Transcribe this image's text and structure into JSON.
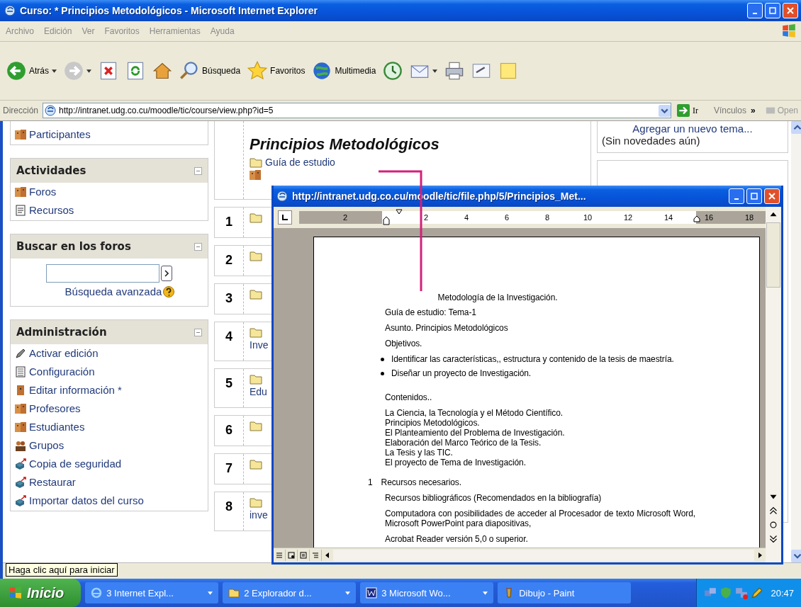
{
  "window": {
    "title": "Curso: * Principios Metodológicos - Microsoft Internet Explorer"
  },
  "menu": [
    "Archivo",
    "Edición",
    "Ver",
    "Favoritos",
    "Herramientas",
    "Ayuda"
  ],
  "toolbar": [
    {
      "kind": "back",
      "label": "Atrás",
      "dropdown": true
    },
    {
      "kind": "forward",
      "dropdown": true
    },
    {
      "kind": "stop"
    },
    {
      "kind": "refresh"
    },
    {
      "kind": "home"
    },
    {
      "kind": "search",
      "label": "Búsqueda"
    },
    {
      "kind": "favorites",
      "label": "Favoritos"
    },
    {
      "kind": "media",
      "label": "Multimedia"
    },
    {
      "kind": "history"
    },
    {
      "kind": "mail",
      "dropdown": true
    },
    {
      "kind": "print"
    },
    {
      "kind": "edit"
    },
    {
      "kind": "note"
    }
  ],
  "address": {
    "label": "Dirección",
    "value": "http://intranet.udg.co.cu/moodle/tic/course/view.php?id=5",
    "go": "Ir",
    "links": "Vínculos",
    "more": "»",
    "link": "Open"
  },
  "sidebar": [
    {
      "kind": "list",
      "items": [
        {
          "kind": "people",
          "label": "Participantes"
        }
      ]
    },
    {
      "kind": "list",
      "title": "Actividades",
      "items": [
        {
          "kind": "people",
          "label": "Foros"
        },
        {
          "kind": "doc",
          "label": "Recursos"
        }
      ]
    },
    {
      "kind": "search",
      "title": "Buscar en los foros",
      "link": "Búsqueda avanzada"
    },
    {
      "kind": "list",
      "title": "Administración",
      "items": [
        {
          "kind": "pencil",
          "label": "Activar edición"
        },
        {
          "kind": "config",
          "label": "Configuración"
        },
        {
          "kind": "person",
          "label": "Editar información *"
        },
        {
          "kind": "people",
          "label": "Profesores"
        },
        {
          "kind": "people",
          "label": "Estudiantes"
        },
        {
          "kind": "group",
          "label": "Grupos"
        },
        {
          "kind": "backup",
          "label": "Copia de seguridad"
        },
        {
          "kind": "restore",
          "label": "Restaurar"
        },
        {
          "kind": "restore",
          "label": "Importar datos del curso"
        }
      ]
    }
  ],
  "course": {
    "title": "Principios Metodológicos",
    "intro_link": "Guía de estudio",
    "sections": [
      {
        "number": "1"
      },
      {
        "number": "2"
      },
      {
        "number": "3"
      },
      {
        "number": "4",
        "text": "Inve"
      },
      {
        "number": "5",
        "text": "Edu"
      },
      {
        "number": "6"
      },
      {
        "number": "7"
      },
      {
        "number": "8",
        "text": "inve"
      }
    ]
  },
  "news": {
    "add_topic": "Agregar un nuevo tema...",
    "status": "(Sin novedades aún)"
  },
  "popup": {
    "title": "http://intranet.udg.co.cu/moodle/tic/file.php/5/Principios_Met...",
    "ruler": [
      "2",
      "2",
      "4",
      "6",
      "8",
      "10",
      "12",
      "14",
      "16",
      "18"
    ],
    "document": [
      {
        "kind": "heading",
        "text": "Metodología de la Investigación."
      },
      {
        "kind": "para",
        "text": "Guía de estudio: Tema-1"
      },
      {
        "kind": "para",
        "text": "Asunto. Principios Metodológicos"
      },
      {
        "kind": "para",
        "text": "Objetivos."
      },
      {
        "kind": "bullet",
        "text": "Identificar las características,, estructura y contenido de la tesis de maestría."
      },
      {
        "kind": "bullet",
        "text": "Diseñar un proyecto de Investigación."
      },
      {
        "kind": "gap"
      },
      {
        "kind": "para",
        "text": "Contenidos.."
      },
      {
        "kind": "line",
        "text": "La Ciencia, la Tecnología y el Método Científico."
      },
      {
        "kind": "line",
        "text": "Principios Metodológicos."
      },
      {
        "kind": "line",
        "text": "El Planteamiento del Problema de Investigación."
      },
      {
        "kind": "line",
        "text": "Elaboración del Marco Teórico de la Tesis."
      },
      {
        "kind": "line",
        "text": "La Tesis y las TIC."
      },
      {
        "kind": "line",
        "text": "El proyecto de Tema de Investigación."
      },
      {
        "kind": "gap"
      },
      {
        "kind": "numbered",
        "number": "1",
        "text": "Recursos necesarios."
      },
      {
        "kind": "para",
        "text": "Recursos bibliográficos (Recomendados en la bibliografía)"
      },
      {
        "kind": "para",
        "text": "Computadora con posibilidades de acceder al Procesador de texto Microsoft Word, Microsoft PowerPoint para diapositivas,"
      },
      {
        "kind": "para",
        "text": "Acrobat Reader versión 5,0 o superior."
      }
    ]
  },
  "tooltip": "Haga clic aquí para iniciar",
  "taskbar": {
    "start": "Inicio",
    "tasks": [
      {
        "kind": "ie",
        "label": "3 Internet Expl...",
        "grouped": true
      },
      {
        "kind": "folder",
        "label": "2 Explorador d...",
        "grouped": true
      },
      {
        "kind": "word",
        "label": "3 Microsoft Wo...",
        "grouped": true
      },
      {
        "kind": "paint",
        "label": "Dibujo - Paint",
        "grouped": false
      }
    ],
    "clock": "20:47"
  }
}
